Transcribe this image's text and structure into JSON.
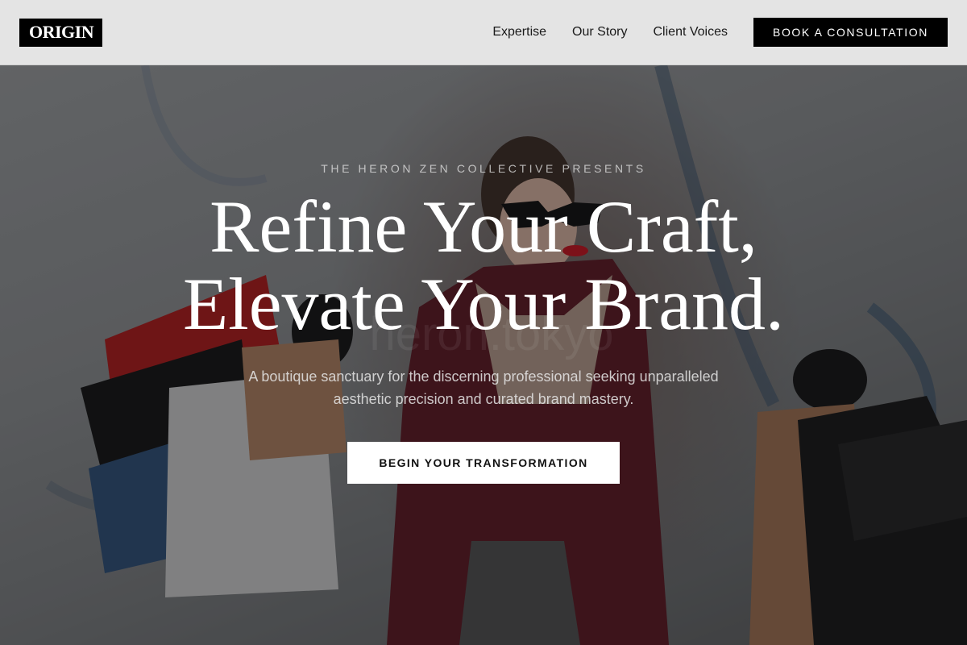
{
  "header": {
    "logo": "ORIGIN",
    "nav": [
      "Expertise",
      "Our Story",
      "Client Voices"
    ],
    "cta": "BOOK A CONSULTATION"
  },
  "hero": {
    "eyebrow": "THE HERON ZEN COLLECTIVE PRESENTS",
    "headline_line1": "Refine Your Craft,",
    "headline_line2": "Elevate Your Brand.",
    "subtext": "A boutique sanctuary for the discerning professional seeking unparalleled aesthetic precision and curated brand mastery.",
    "cta": "BEGIN YOUR TRANSFORMATION",
    "watermark": "heron.tokyo",
    "image_subject": "woman-with-shopping-bags-photo"
  },
  "colors": {
    "header_bg": "#e4e4e4",
    "brand_black": "#000000",
    "hero_overlay": "#141416",
    "coat_red": "#5c1620",
    "bag_red": "#b01818"
  }
}
